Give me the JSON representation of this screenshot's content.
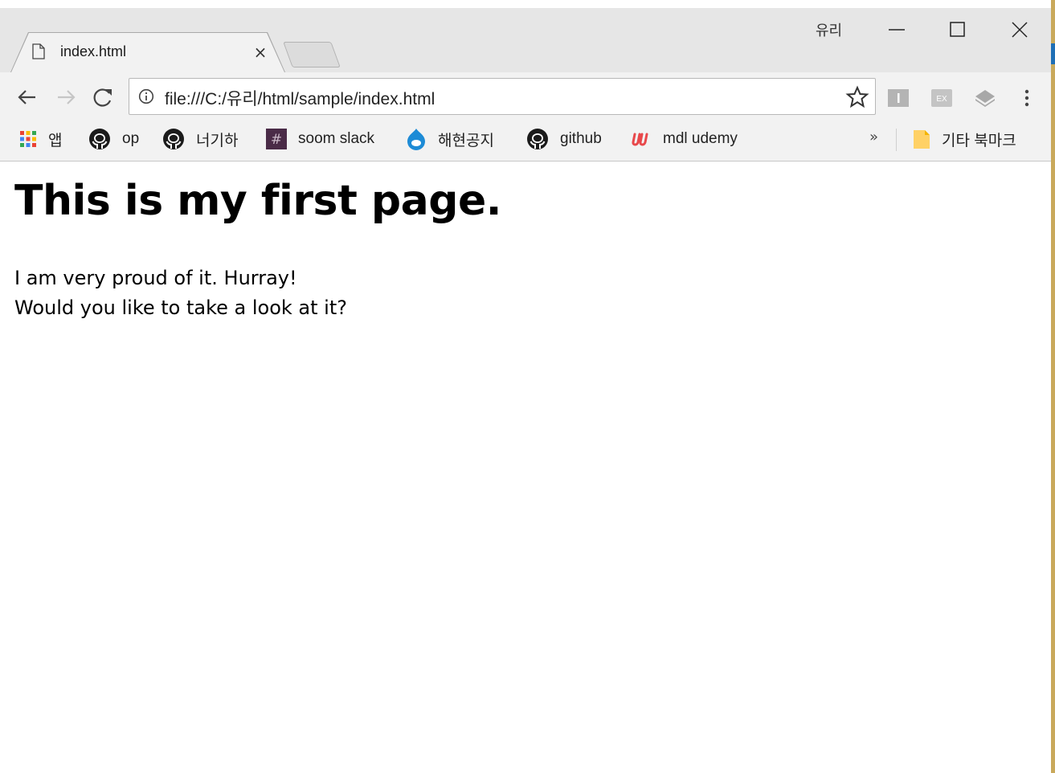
{
  "window": {
    "profile_name": "유리",
    "controls": [
      "minimize",
      "maximize",
      "close"
    ]
  },
  "tab": {
    "title": "index.html",
    "close_glyph": "×"
  },
  "toolbar": {
    "url": "file:///C:/유리/html/sample/index.html",
    "icons": [
      "back-icon",
      "forward-icon",
      "reload-icon",
      "info-icon",
      "star-icon",
      "menu-icon"
    ]
  },
  "bookmarks": {
    "items": [
      {
        "label": "앱",
        "icon": "apps-grid-icon"
      },
      {
        "label": "op",
        "icon": "github-icon"
      },
      {
        "label": "너기하",
        "icon": "github-icon"
      },
      {
        "label": "soom slack",
        "icon": "slack-icon"
      },
      {
        "label": "해현공지",
        "icon": "drupal-icon"
      },
      {
        "label": "github",
        "icon": "github-icon"
      },
      {
        "label": "mdl udemy",
        "icon": "udemy-icon"
      }
    ],
    "overflow": "»",
    "other_folder": "기타 북마크"
  },
  "page": {
    "heading": "This is my first page.",
    "line1": "I am very proud of it. Hurray!",
    "line2": "Would you like to take a look at it?"
  },
  "colors": {
    "chrome_bg": "#f2f2f2",
    "titlebar_bg": "#e6e6e6",
    "udemy": "#e8484b",
    "slack": "#4a2b47"
  }
}
